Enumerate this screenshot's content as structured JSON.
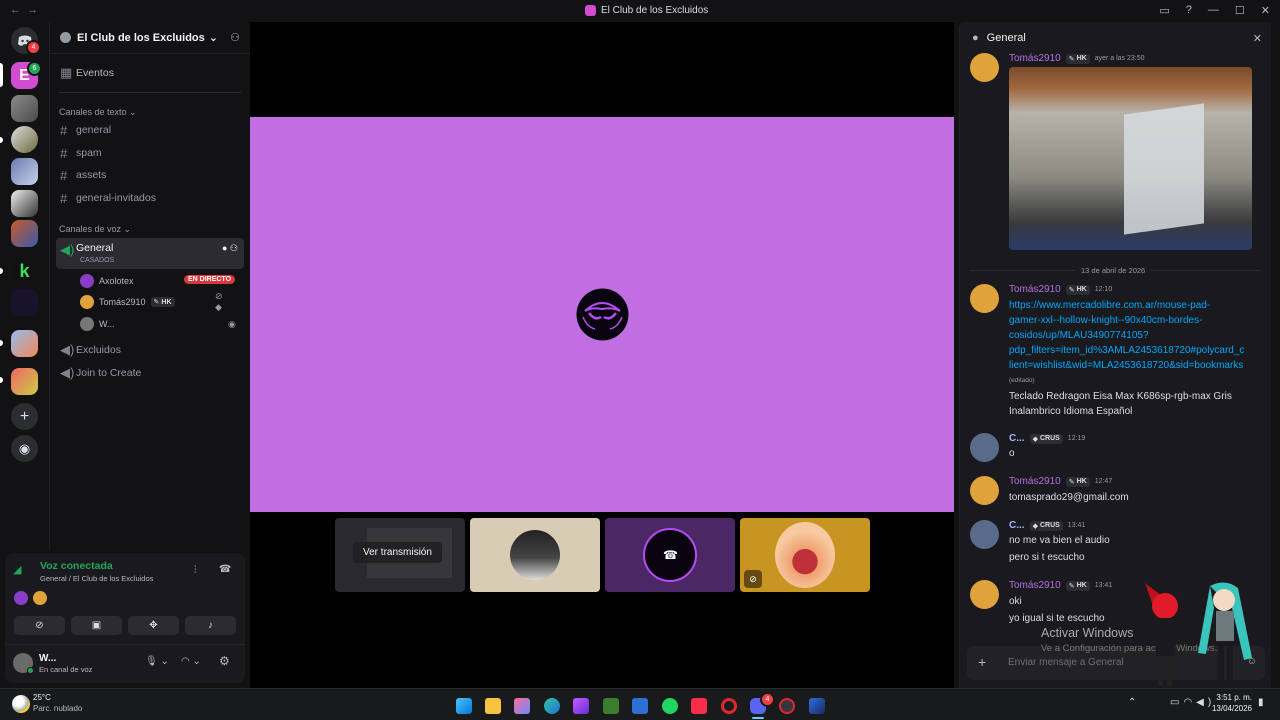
{
  "window": {
    "title": "El Club de los Excluidos",
    "nav_back": "←",
    "nav_forward": "→"
  },
  "servers": {
    "home_badge": "4",
    "server_badge": "6"
  },
  "guild": {
    "name": "El Club de los Excluidos",
    "events_label": "Eventos",
    "text_category": "Canales de texto",
    "text_channels": [
      "general",
      "spam",
      "assets",
      "general-invitados"
    ],
    "voice_category": "Canales de voz",
    "active_voice": {
      "name": "General",
      "status": "CASADOS"
    },
    "voice_users": [
      {
        "name": "Axolotex",
        "live_badge": "EN DIRECTO"
      },
      {
        "name": "Tomás2910",
        "tag": "HK"
      },
      {
        "name": "W..."
      }
    ],
    "other_voice": [
      "Excluidos",
      "Join to Create"
    ]
  },
  "voice_panel": {
    "status": "Voz conectada",
    "location": "General / El Club de los Excluidos",
    "user": {
      "name": "W...",
      "status": "En canal de voz"
    }
  },
  "stage": {
    "tile_label": "Ver transmisión"
  },
  "chat": {
    "channel": "General",
    "input_placeholder": "Enviar mensaje a General",
    "date_divider": "13 de abril de 2026",
    "messages": [
      {
        "user": "Tomás2910",
        "tag": "HK",
        "time": "ayer a las 23:50",
        "lines": []
      },
      {
        "user": "Tomás2910",
        "tag": "HK",
        "time": "12:10",
        "link_lines": [
          "https://www.mercadolibre.com.ar/mouse-pad-",
          "gamer-xxl--hollow-knight--90x40cm-bordes-",
          "cosidos/up/MLAU3490774105?",
          "pdp_filters=item_id%3AMLA2453618720#polycard_c",
          "lient=wishlist&wid=MLA2453618720&sid=bookmarks"
        ],
        "edited": "(editado)",
        "lines": [
          "Teclado Redragon Eisa Max K686sp-rgb-max Gris",
          "Inalambrico Idioma Español"
        ]
      },
      {
        "user": "C...",
        "tag": "CRUS",
        "time": "12:19",
        "lines": [
          "o"
        ]
      },
      {
        "user": "Tomás2910",
        "tag": "HK",
        "time": "12:47",
        "lines": [
          "tomasprado29@gmail.com"
        ]
      },
      {
        "user": "C...",
        "tag": "CRUS",
        "time": "13:41",
        "lines": [
          "no me va bien el audio",
          "pero si t escucho"
        ]
      },
      {
        "user": "Tomás2910",
        "tag": "HK",
        "time": "13:41",
        "lines": [
          "oki",
          "yo igual si te escucho"
        ]
      }
    ]
  },
  "watermark": {
    "title": "Activar Windows",
    "subtitle": "Ve a Configuración para activar Windows."
  },
  "taskbar": {
    "temp": "25°C",
    "weather": "Parc. nublado",
    "time": "3:51 p. m.",
    "date": "13/04/2026",
    "discord_badge": "4"
  },
  "colors": {
    "accent": "#c16ee2",
    "link": "#00a8fc",
    "live": "#da373c",
    "online": "#23a55a",
    "bg": "#121214"
  }
}
